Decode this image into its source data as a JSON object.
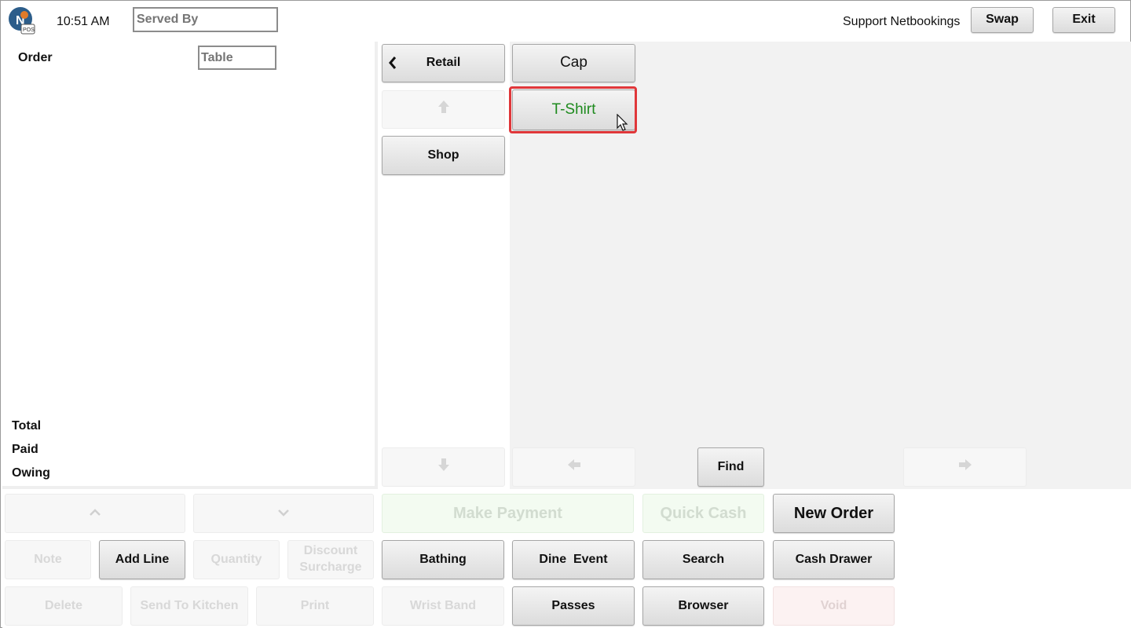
{
  "header": {
    "time": "10:51 AM",
    "served_by_placeholder": "Served By",
    "user_name": "Support Netbookings",
    "swap_label": "Swap",
    "exit_label": "Exit"
  },
  "order_panel": {
    "order_label": "Order",
    "table_placeholder": "Table",
    "total_label": "Total",
    "paid_label": "Paid",
    "owing_label": "Owing"
  },
  "categories": {
    "back_label": "Retail",
    "back_icon": "chevron-left-icon",
    "items": [
      {
        "label": "Shop"
      }
    ],
    "scroll_up_icon": "arrow-up-icon",
    "scroll_down_icon": "arrow-down-icon"
  },
  "products": {
    "items": [
      {
        "label": "Cap",
        "selected": false
      },
      {
        "label": "T-Shirt",
        "selected": true,
        "color": "#1e8a1e"
      }
    ],
    "find_label": "Find",
    "prev_icon": "arrow-left-icon",
    "next_icon": "arrow-right-icon"
  },
  "line_actions": {
    "scroll_up_icon": "chevron-up-icon",
    "scroll_down_icon": "chevron-down-icon",
    "note_label": "Note",
    "add_line_label": "Add Line",
    "quantity_label": "Quantity",
    "discount_label": "Discount Surcharge",
    "delete_label": "Delete",
    "send_to_kitchen_label": "Send To Kitchen",
    "print_label": "Print"
  },
  "actions": {
    "make_payment_label": "Make Payment",
    "quick_cash_label": "Quick Cash",
    "new_order_label": "New Order",
    "bathing_label": "Bathing",
    "dine_event_label": "Dine  Event",
    "search_label": "Search",
    "cash_drawer_label": "Cash Drawer",
    "wrist_band_label": "Wrist Band",
    "passes_label": "Passes",
    "browser_label": "Browser",
    "void_label": "Void"
  },
  "colors": {
    "selected_border": "#e0373a",
    "selected_text": "#1e8a1e",
    "grid_background": "#f2f2f2"
  }
}
